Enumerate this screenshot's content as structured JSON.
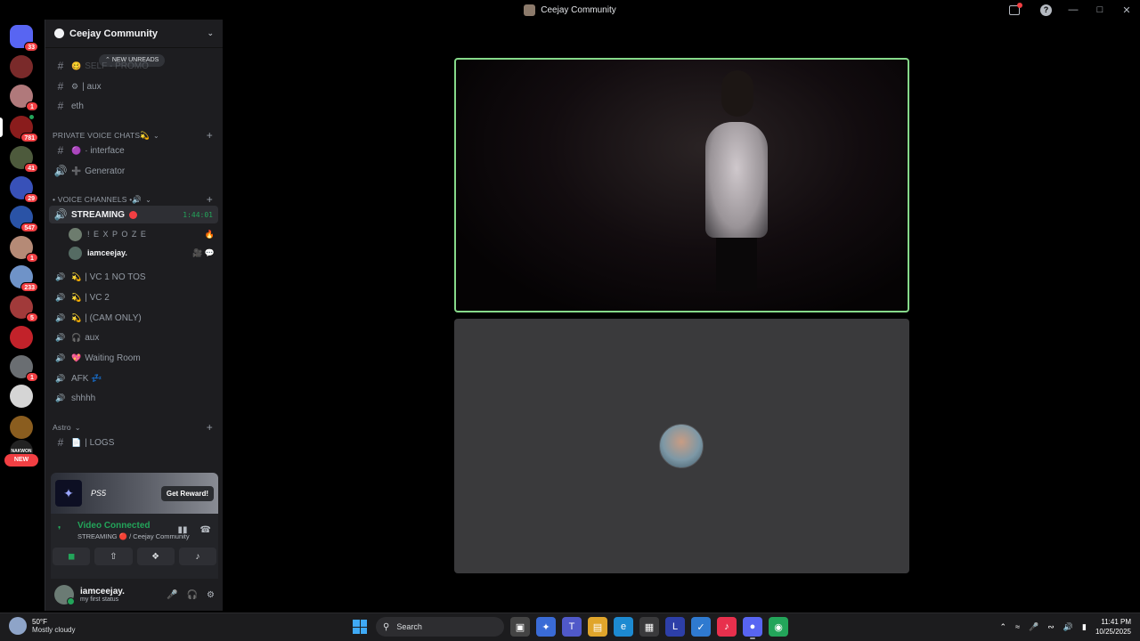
{
  "window": {
    "title": "Ceejay Community"
  },
  "rail": {
    "servers": [
      {
        "name": "home",
        "badge": "33",
        "color": "#5865f2"
      },
      {
        "name": "server-2",
        "badge": "",
        "color": "#7a2a2a"
      },
      {
        "name": "server-3",
        "badge": "1",
        "color": "#b0797b"
      },
      {
        "name": "server-4",
        "badge": "781",
        "color": "#8a1c1c"
      },
      {
        "name": "server-5",
        "badge": "41",
        "color": "#4d5a3c"
      },
      {
        "name": "server-6",
        "badge": "29",
        "color": "#3851b8"
      },
      {
        "name": "server-7",
        "badge": "547",
        "color": "#2a53a6"
      },
      {
        "name": "server-8",
        "badge": "1",
        "color": "#b58a76"
      },
      {
        "name": "server-9",
        "badge": "233",
        "color": "#6f93c8"
      },
      {
        "name": "server-10",
        "badge": "5",
        "color": "#a13a3a"
      },
      {
        "name": "server-11",
        "badge": "",
        "color": "#c2222a"
      },
      {
        "name": "server-12",
        "badge": "1",
        "color": "#6a6e72"
      },
      {
        "name": "server-13",
        "badge": "",
        "color": "#d5d5d5"
      },
      {
        "name": "server-14",
        "badge": "",
        "color": "#8a5d1f"
      },
      {
        "name": "server-15",
        "badge": "",
        "color": "#222"
      }
    ],
    "new_label": "NEW",
    "server_15_text": "NAKWON"
  },
  "server": {
    "name": "Ceejay Community"
  },
  "sidebar": {
    "new_unreads": "NEW UNREADS",
    "channels_top": [
      {
        "sym": "#",
        "emoji": "🥴",
        "label": "SELF - PROMO"
      },
      {
        "sym": "#",
        "emoji": "⚙",
        "label": "| aux"
      },
      {
        "sym": "#",
        "emoji": "",
        "label": "eth"
      }
    ],
    "cat_private": "PRIVATE VOICE CHATS💫",
    "private_channels": [
      {
        "sym": "#",
        "emoji": "🟣",
        "label": "· interface"
      },
      {
        "sym": "🔊",
        "emoji": "➕",
        "label": "Generator"
      }
    ],
    "cat_voice": "• VOICE CHANNELS •🔊",
    "active_channel": {
      "label": "STREAMING",
      "timer": "1:44:01"
    },
    "members": [
      {
        "name": "! E X P O Z E",
        "side": "🔥"
      },
      {
        "name": "iamceejay.",
        "side": "🎥 💬"
      }
    ],
    "voice_channels": [
      {
        "emoji": "💫",
        "label": "| VC 1 NO TOS"
      },
      {
        "emoji": "💫",
        "label": "| VC 2"
      },
      {
        "emoji": "💫",
        "label": "| (CAM ONLY)"
      },
      {
        "emoji": "🎧",
        "label": "aux"
      },
      {
        "emoji": "💖",
        "label": "Waiting Room"
      },
      {
        "emoji": "",
        "label": "AFK 💤"
      },
      {
        "emoji": "",
        "label": "shhhh"
      }
    ],
    "cat_astro": "Astro",
    "astro_channels": [
      {
        "sym": "#",
        "emoji": "📄",
        "label": "| LOGS"
      }
    ]
  },
  "promo": {
    "brand": "PS5",
    "button": "Get Reward!"
  },
  "voice": {
    "status": "Video Connected",
    "location": "STREAMING 🔴 / Ceejay Community"
  },
  "user": {
    "name": "iamceejay.",
    "status": "my first status"
  },
  "taskbar": {
    "temp": "50°F",
    "weather": "Mostly cloudy",
    "search": "Search",
    "time": "11:41 PM",
    "date": "10/25/2025"
  }
}
